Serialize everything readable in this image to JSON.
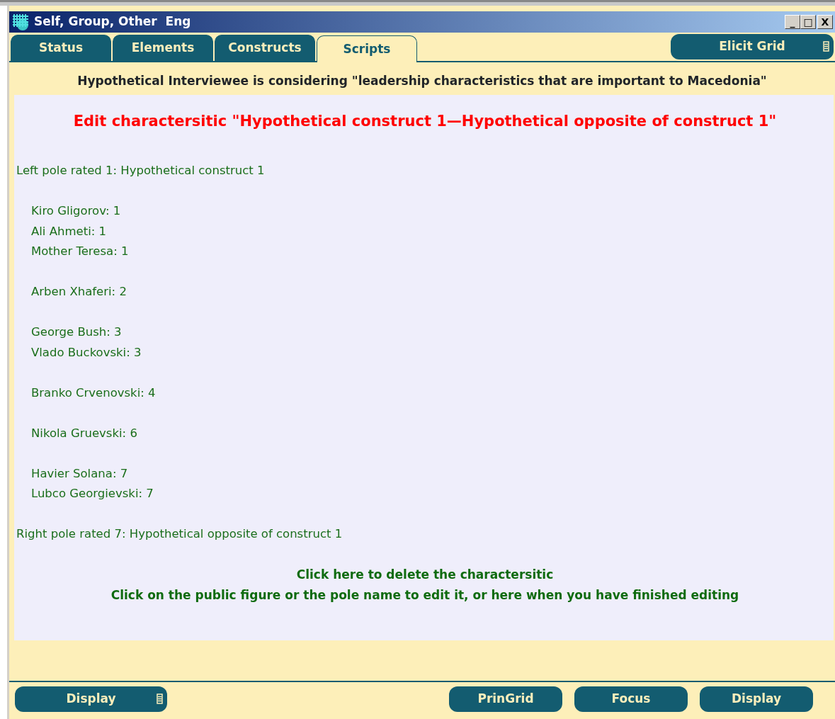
{
  "window": {
    "title": "Self, Group, Other  Eng",
    "controls": [
      "_",
      "□",
      "X"
    ]
  },
  "tabs": [
    {
      "label": "Status",
      "selected": false
    },
    {
      "label": "Elements",
      "selected": false
    },
    {
      "label": "Constructs",
      "selected": false
    },
    {
      "label": "Scripts",
      "selected": true
    }
  ],
  "top_button": {
    "label": "Elicit Grid",
    "menu": true
  },
  "heading": "Hypothetical Interviewee is considering \"leadership characteristics that are important to Macedonia\"",
  "panel": {
    "title": "Edit charactersitic \"Hypothetical construct 1—Hypothetical opposite of construct 1\"",
    "left_pole": "Left pole rated 1: Hypothetical construct 1",
    "groups": [
      {
        "items": [
          "Kiro Gligorov: 1",
          "Ali Ahmeti: 1",
          "Mother Teresa: 1"
        ]
      },
      {
        "items": [
          "Arben Xhaferi: 2"
        ]
      },
      {
        "items": [
          "George Bush: 3",
          "Vlado Buckovski: 3"
        ]
      },
      {
        "items": [
          "Branko Crvenovski: 4"
        ]
      },
      {
        "items": [
          "Nikola Gruevski: 6"
        ]
      },
      {
        "items": [
          "Havier Solana: 7",
          "Lubco Georgievski: 7"
        ]
      }
    ],
    "right_pole": "Right pole rated 7: Hypothetical opposite of construct 1",
    "links": [
      "Click here to delete the charactersitic",
      "Click on the public figure or the pole name to edit it, or here when you have finished editing"
    ]
  },
  "bottom_buttons": [
    {
      "label": "Display",
      "menu": true
    },
    {
      "label": "PrinGrid",
      "menu": false
    },
    {
      "label": "Focus",
      "menu": false
    },
    {
      "label": "Display",
      "menu": false
    }
  ]
}
